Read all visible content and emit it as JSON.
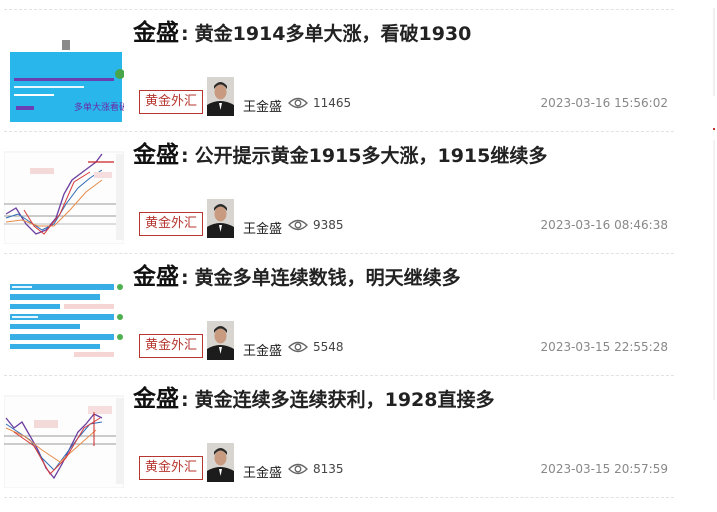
{
  "articles": [
    {
      "brand": "金盛",
      "colon": ":",
      "title": "黄金1914多单大涨，看破1930",
      "tag": "黄金外汇",
      "author": "王金盛",
      "views": "11465",
      "date": "2023-03-16 15:56:02",
      "thumb_type": "banner",
      "thumb_text": "多单大涨看破"
    },
    {
      "brand": "金盛",
      "colon": ":",
      "title": "公开提示黄金1915多大涨，1915继续多",
      "tag": "黄金外汇",
      "author": "王金盛",
      "views": "9385",
      "date": "2023-03-16 08:46:38",
      "thumb_type": "chart"
    },
    {
      "brand": "金盛",
      "colon": ":",
      "title": "黄金多单连续数钱，明天继续多",
      "tag": "黄金外汇",
      "author": "王金盛",
      "views": "5548",
      "date": "2023-03-15 22:55:28",
      "thumb_type": "chat"
    },
    {
      "brand": "金盛",
      "colon": ":",
      "title": "黄金连续多连续获利，1928直接多",
      "tag": "黄金外汇",
      "author": "王金盛",
      "views": "8135",
      "date": "2023-03-15 20:57:59",
      "thumb_type": "chart"
    }
  ],
  "colors": {
    "tag_red": "#b5372f",
    "date_gray": "#888888",
    "banner_blue": "#29b6ea"
  },
  "icons": {
    "views": "eye-icon"
  }
}
